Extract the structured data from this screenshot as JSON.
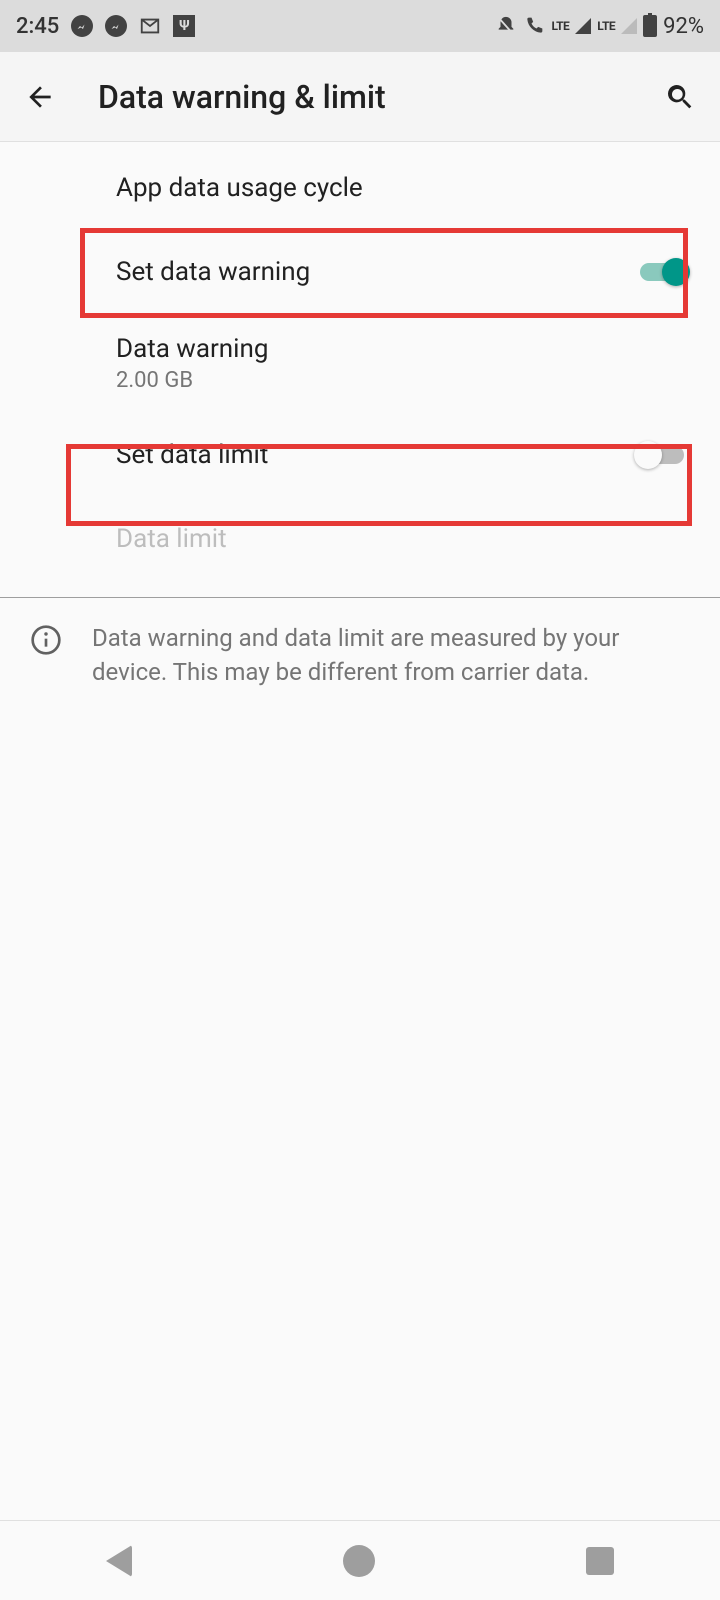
{
  "status": {
    "time": "2:45",
    "battery": "92%",
    "network_label": "LTE"
  },
  "header": {
    "title": "Data warning & limit"
  },
  "prefs": {
    "usage_cycle": {
      "title": "App data usage cycle"
    },
    "set_warning": {
      "title": "Set data warning",
      "value": true
    },
    "data_warning": {
      "title": "Data warning",
      "summary": "2.00 GB"
    },
    "set_limit": {
      "title": "Set data limit",
      "value": false
    },
    "data_limit": {
      "title": "Data limit",
      "enabled": false
    }
  },
  "footer": {
    "text": "Data warning and data limit are measured by your device. This may be different from carrier data."
  }
}
